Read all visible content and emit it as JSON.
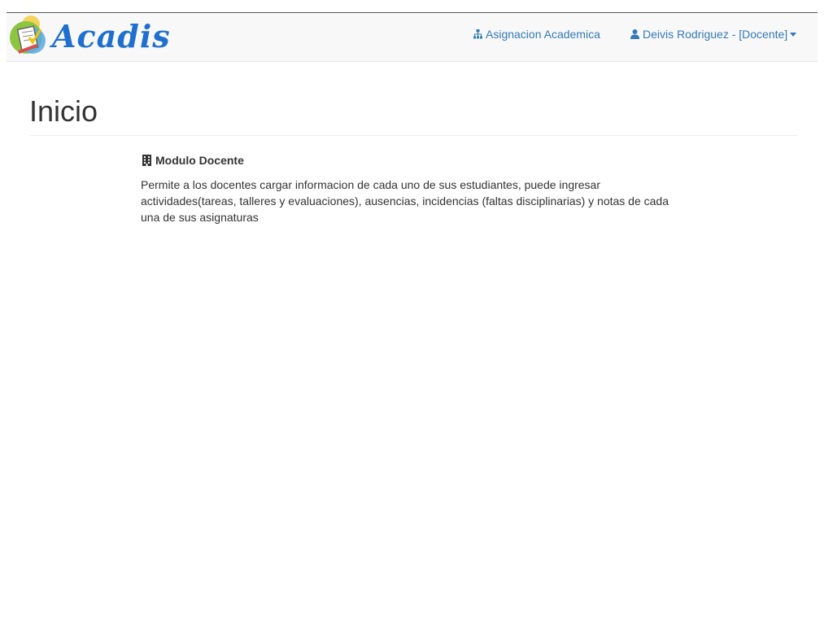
{
  "navbar": {
    "brand": {
      "text": "Acadis"
    },
    "links": [
      {
        "label": "Asignacion Academica",
        "icon": "sitemap-icon"
      },
      {
        "label": "Deivis Rodriguez - [Docente]",
        "icon": "user-icon",
        "dropdown": true
      }
    ],
    "colors": {
      "background": "#f8f8f8",
      "link": "#337ab7",
      "brand": "#1e6fcf"
    }
  },
  "page": {
    "title": "Inicio",
    "module": {
      "heading": "Modulo Docente",
      "icon": "building-icon",
      "description": "Permite a los docentes cargar informacion de cada uno de sus estudiantes, puede ingresar actividades(tareas, talleres y evaluaciones), ausencias, incidencias (faltas disciplinarias) y notas de cada una de sus asignaturas"
    }
  }
}
